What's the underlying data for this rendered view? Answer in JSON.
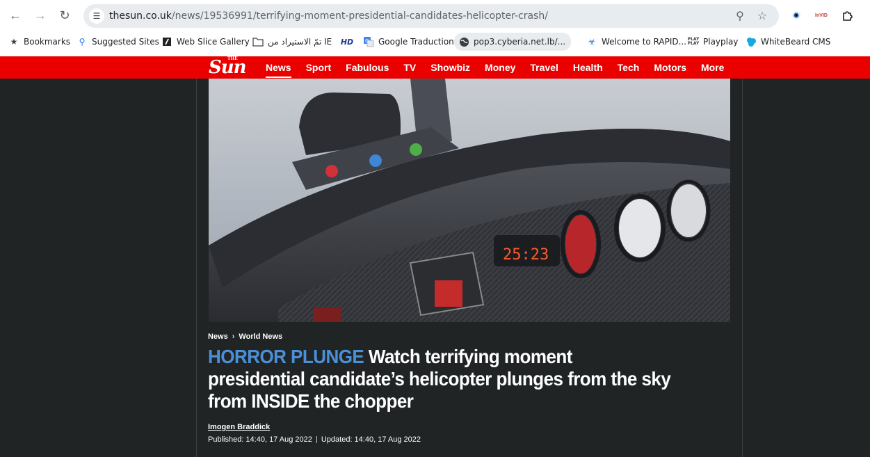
{
  "browser": {
    "url_host": "thesun.co.uk",
    "url_path": "/news/19536991/terrifying-moment-presidential-candidates-helicopter-crash/",
    "bookmarks": [
      {
        "label": "Bookmarks",
        "icon": "star-icon"
      },
      {
        "label": "Suggested Sites",
        "icon": "search-icon"
      },
      {
        "label": "Web Slice Gallery",
        "icon": "web-slice-icon"
      },
      {
        "label": "تمّ الاستيراد من IE",
        "icon": "folder-icon"
      },
      {
        "label": "",
        "icon": "hd-icon"
      },
      {
        "label": "Google Traduction",
        "icon": "translate-icon"
      },
      {
        "label": "pop3.cyberia.net.lb/...",
        "icon": "globe-icon"
      },
      {
        "label": "Welcome to RAPID...",
        "icon": "rapid-icon"
      },
      {
        "label": "Playplay",
        "icon": "playplay-icon"
      },
      {
        "label": "WhiteBeard CMS",
        "icon": "whitebeard-icon"
      }
    ],
    "hd_label": "HD",
    "invid_label": "InVID"
  },
  "site": {
    "logo": "Sun",
    "logo_the": "THE",
    "nav": [
      "News",
      "Sport",
      "Fabulous",
      "TV",
      "Showbiz",
      "Money",
      "Travel",
      "Health",
      "Tech",
      "Motors",
      "More"
    ],
    "active_nav": "News"
  },
  "article": {
    "breadcrumb": [
      "News",
      "World News"
    ],
    "kicker": "HORROR PLUNGE",
    "headline": "Watch terrifying moment presidential candidate’s helicopter plunges from the sky from INSIDE the chopper",
    "author": "Imogen Braddick",
    "published": "Published: 14:40, 17 Aug 2022",
    "updated": "Updated: 14:40, 17 Aug 2022",
    "video_display": "25:23"
  }
}
